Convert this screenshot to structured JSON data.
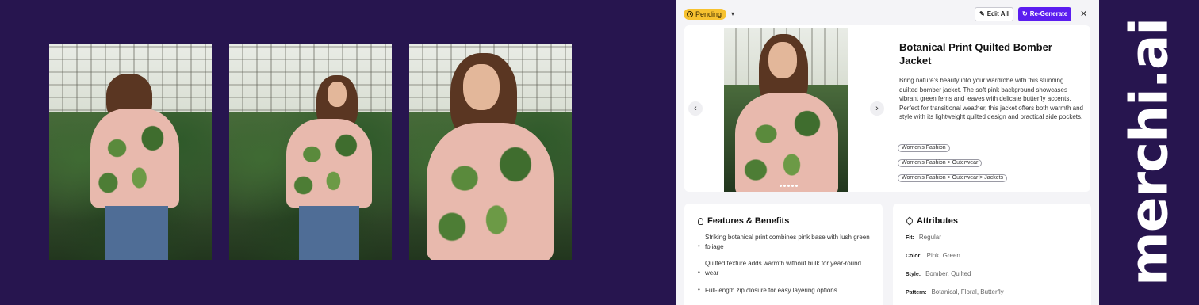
{
  "brand": {
    "logo_text": "merchi.ai"
  },
  "gallery": {
    "images": [
      {
        "name": "back-view"
      },
      {
        "name": "side-view"
      },
      {
        "name": "front-view"
      }
    ]
  },
  "toolbar": {
    "status_label": "Pending",
    "edit_all_label": "Edit All",
    "regenerate_label": "Re-Generate",
    "close_symbol": "✕",
    "status_color": "#f7c230",
    "accent_color": "#5b1df0"
  },
  "product": {
    "title": "Botanical Print Quilted Bomber Jacket",
    "description": "Bring nature's beauty into your wardrobe with this stunning quilted bomber jacket. The soft pink background showcases vibrant green ferns and leaves with delicate butterfly accents. Perfect for transitional weather, this jacket offers both warmth and style with its lightweight quilted design and practical side pockets.",
    "categories": [
      "Women's Fashion",
      "Women's Fashion > Outerwear",
      "Women's Fashion > Outerwear > Jackets"
    ],
    "carousel": {
      "prev_symbol": "‹",
      "next_symbol": "›",
      "dot_count": 5
    }
  },
  "features": {
    "title": "Features & Benefits",
    "items": [
      "Striking botanical print combines pink base with lush green foliage",
      "Quilted texture adds warmth without bulk for year-round wear",
      "Full-length zip closure for easy layering options"
    ]
  },
  "attributes": {
    "title": "Attributes",
    "items": [
      {
        "label": "Fit:",
        "value": "Regular"
      },
      {
        "label": "Color:",
        "value": "Pink, Green"
      },
      {
        "label": "Style:",
        "value": "Bomber, Quilted"
      },
      {
        "label": "Pattern:",
        "value": "Botanical, Floral, Butterfly"
      }
    ]
  },
  "colors": {
    "background": "#27154f",
    "panel": "#f4f4f7"
  }
}
